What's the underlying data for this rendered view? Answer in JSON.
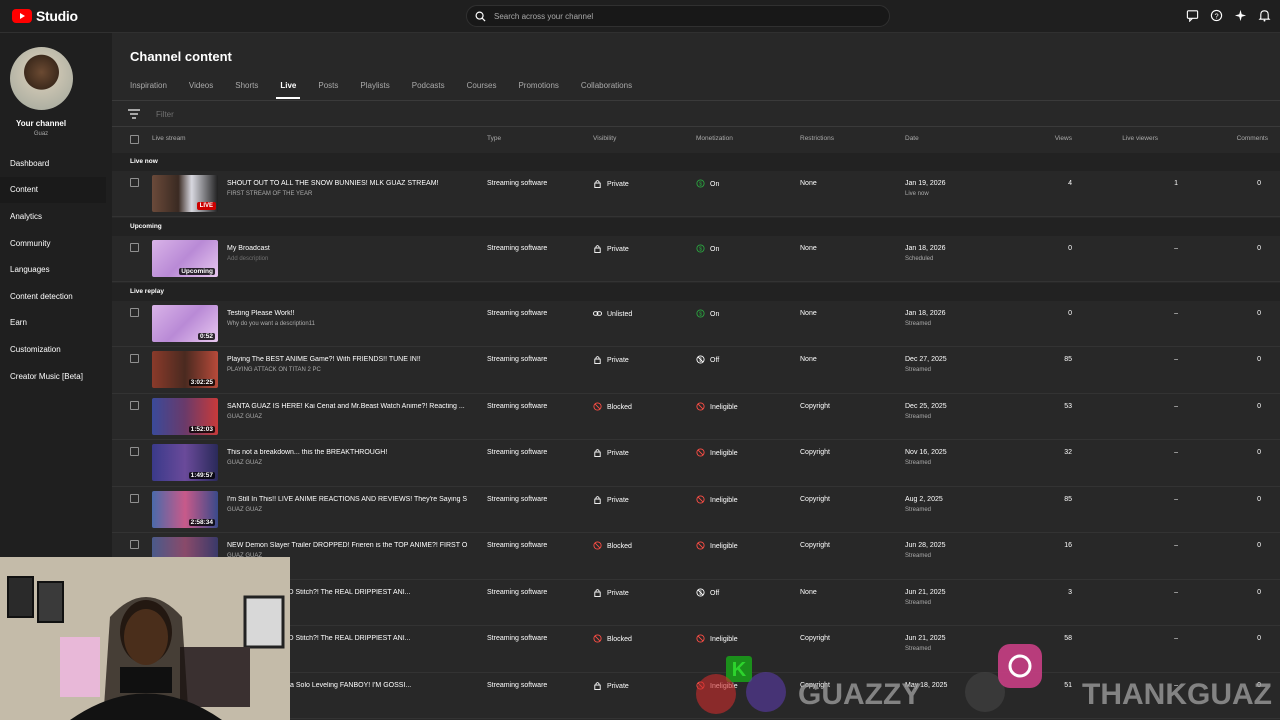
{
  "app": {
    "name": "Studio"
  },
  "search": {
    "placeholder": "Search across your channel"
  },
  "channel": {
    "title": "Your channel",
    "handle": "Guaz"
  },
  "nav": [
    "Dashboard",
    "Content",
    "Analytics",
    "Community",
    "Languages",
    "Content detection",
    "Earn",
    "Customization",
    "Creator Music [Beta]"
  ],
  "page": {
    "title": "Channel content"
  },
  "tabs": [
    "Inspiration",
    "Videos",
    "Shorts",
    "Live",
    "Posts",
    "Playlists",
    "Podcasts",
    "Courses",
    "Promotions",
    "Collaborations"
  ],
  "filter": {
    "placeholder": "Filter"
  },
  "columns": [
    "Live stream",
    "Type",
    "Visibility",
    "Monetization",
    "Restrictions",
    "Date",
    "Views",
    "Live viewers",
    "Comments"
  ],
  "sections": [
    "Live now",
    "Upcoming",
    "Live replay"
  ],
  "rows": [
    {
      "title": "SHOUT OUT TO ALL THE SNOW BUNNIES! MLK GUAZ STREAM!",
      "desc": "FIRST STREAM OF THE YEAR",
      "badge": "LIVE",
      "type": "Streaming software",
      "visibility": "Private",
      "monetization": "On",
      "restrictions": "None",
      "date": "Jan 19, 2026",
      "date_sub": "Live now",
      "views": "4",
      "live_viewers": "1",
      "comments": "0"
    },
    {
      "title": "My Broadcast",
      "desc": "Add description",
      "badge": "Upcoming",
      "type": "Streaming software",
      "visibility": "Private",
      "monetization": "On",
      "restrictions": "None",
      "date": "Jan 18, 2026",
      "date_sub": "Scheduled",
      "views": "0",
      "live_viewers": "–",
      "comments": "0"
    },
    {
      "title": "Testing Please Work!!",
      "desc": "Why do you want a description11",
      "badge": "0:52",
      "type": "Streaming software",
      "visibility": "Unlisted",
      "monetization": "On",
      "restrictions": "None",
      "date": "Jan 18, 2026",
      "date_sub": "Streamed",
      "views": "0",
      "live_viewers": "–",
      "comments": "0"
    },
    {
      "title": "Playing The BEST ANIME Game?! With FRIENDS!! TUNE IN!!",
      "desc": "PLAYING ATTACK ON TITAN 2 PC",
      "badge": "3:02:25",
      "type": "Streaming software",
      "visibility": "Private",
      "monetization": "Off",
      "restrictions": "None",
      "date": "Dec 27, 2025",
      "date_sub": "Streamed",
      "views": "85",
      "live_viewers": "–",
      "comments": "0"
    },
    {
      "title": "SANTA GUAZ IS HERE! Kai Cenat and Mr.Beast Watch Anime?! Reacting ...",
      "desc": "GUAZ GUAZ",
      "badge": "1:52:03",
      "type": "Streaming software",
      "visibility": "Blocked",
      "monetization": "Ineligible",
      "restrictions": "Copyright",
      "date": "Dec 25, 2025",
      "date_sub": "Streamed",
      "views": "53",
      "live_viewers": "–",
      "comments": "0"
    },
    {
      "title": "This not a breakdown... this the BREAKTHROUGH!",
      "desc": "GUAZ GUAZ",
      "badge": "1:49:57",
      "type": "Streaming software",
      "visibility": "Private",
      "monetization": "Ineligible",
      "restrictions": "Copyright",
      "date": "Nov 16, 2025",
      "date_sub": "Streamed",
      "views": "32",
      "live_viewers": "–",
      "comments": "0"
    },
    {
      "title": "I'm Still In This!! LIVE ANIME REACTIONS AND REVIEWS! They're Saying S...",
      "desc": "GUAZ GUAZ",
      "badge": "2:58:34",
      "type": "Streaming software",
      "visibility": "Private",
      "monetization": "Ineligible",
      "restrictions": "Copyright",
      "date": "Aug 2, 2025",
      "date_sub": "Streamed",
      "views": "85",
      "live_viewers": "–",
      "comments": "0"
    },
    {
      "title": "NEW Demon Slayer Trailer DROPPED! Frieren is the TOP ANIME?! FIRST O...",
      "desc": "GUAZ GUAZ",
      "badge": "",
      "type": "Streaming software",
      "visibility": "Blocked",
      "monetization": "Ineligible",
      "restrictions": "Copyright",
      "date": "Jun 28, 2025",
      "date_sub": "Streamed",
      "views": "16",
      "live_viewers": "–",
      "comments": "0"
    },
    {
      "title": "FF?! Disney RUINED Stitch?! The REAL DRIPPIEST ANI...",
      "desc": "",
      "badge": "",
      "type": "Streaming software",
      "visibility": "Private",
      "monetization": "Off",
      "restrictions": "None",
      "date": "Jun 21, 2025",
      "date_sub": "Streamed",
      "views": "3",
      "live_viewers": "–",
      "comments": "0"
    },
    {
      "title": "FF?! Disney RUINED Stitch?! The REAL DRIPPIEST ANI...",
      "desc": "",
      "badge": "",
      "type": "Streaming software",
      "visibility": "Blocked",
      "monetization": "Ineligible",
      "restrictions": "Copyright",
      "date": "Jun 21, 2025",
      "date_sub": "Streamed",
      "views": "58",
      "live_viewers": "–",
      "comments": "0"
    },
    {
      "title": "ALLEGATIONS. I'm a Solo Leveling FANBOY! I'M GOSSI...",
      "desc": "",
      "badge": "",
      "type": "Streaming software",
      "visibility": "Private",
      "monetization": "Ineligible",
      "restrictions": "Copyright",
      "date": "May 18, 2025",
      "date_sub": "",
      "views": "51",
      "live_viewers": "–",
      "comments": "0"
    }
  ],
  "overlay": {
    "brand1": "GUAZZY",
    "brand2": "THANKGUAZ"
  },
  "colors": {
    "accent": "#ff0000",
    "monetized": "#2ba640",
    "ineligible": "#ff4e45",
    "live": "#cc0000"
  }
}
